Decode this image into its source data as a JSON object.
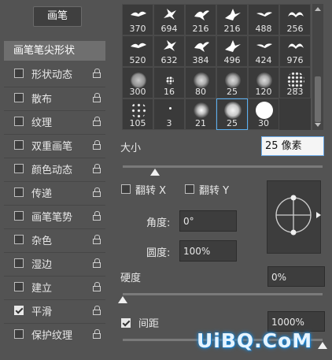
{
  "left_panel": {
    "brush_button": "画笔",
    "tip_shape": "画笔笔尖形状",
    "items": [
      {
        "label": "形状动态",
        "checked": false
      },
      {
        "label": "散布",
        "checked": false
      },
      {
        "label": "纹理",
        "checked": false
      },
      {
        "label": "双重画笔",
        "checked": false
      },
      {
        "label": "颜色动态",
        "checked": false
      },
      {
        "label": "传递",
        "checked": false
      },
      {
        "label": "画笔笔势",
        "checked": false
      },
      {
        "label": "杂色",
        "checked": false
      },
      {
        "label": "湿边",
        "checked": false
      },
      {
        "label": "建立",
        "checked": false
      },
      {
        "label": "平滑",
        "checked": true
      },
      {
        "label": "保护纹理",
        "checked": false
      }
    ]
  },
  "brush_grid": {
    "rows": [
      [
        "370",
        "694",
        "216",
        "216",
        "488",
        "256"
      ],
      [
        "520",
        "632",
        "384",
        "496",
        "424",
        "976"
      ],
      [
        "300",
        "16",
        "80",
        "25",
        "120",
        "283"
      ],
      [
        "105",
        "3",
        "21",
        "25",
        "30"
      ]
    ],
    "selected": "25"
  },
  "size": {
    "label": "大小",
    "value": "25 像素",
    "slider": 0.16
  },
  "flip": {
    "x_label": "翻转 X",
    "y_label": "翻转 Y",
    "x": false,
    "y": false
  },
  "angle": {
    "label": "角度:",
    "value": "0°"
  },
  "roundness": {
    "label": "圆度:",
    "value": "100%"
  },
  "hardness": {
    "label": "硬度",
    "value": "0%",
    "slider": 0.0
  },
  "spacing": {
    "label": "间距",
    "value": "1000%",
    "checked": true,
    "slider": 1.0
  },
  "watermark": "UiBQ.CoM",
  "colors": {
    "panel": "#535353",
    "selection": "#5aaff0",
    "input_bg": "#3d3d3d"
  }
}
